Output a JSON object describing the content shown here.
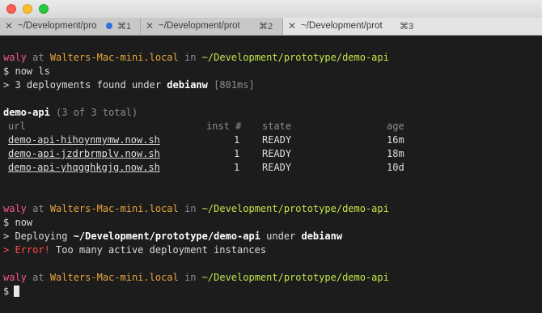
{
  "window": {
    "traffic_lights": [
      "close",
      "minimize",
      "zoom"
    ]
  },
  "tabs": [
    {
      "title": "~/Development/pro",
      "close": "✕",
      "has_dot": true,
      "shortcut": "⌘1"
    },
    {
      "title": "~/Development/prot",
      "close": "✕",
      "has_dot": false,
      "shortcut": "⌘2"
    },
    {
      "title": "~/Development/prot",
      "close": "✕",
      "has_dot": false,
      "shortcut": "⌘3"
    }
  ],
  "prompt": {
    "user": "waly",
    "at": " at ",
    "host": "Walters-Mac-mini.local",
    "in": " in ",
    "path": "~/Development/prototype/demo-api",
    "symbol": "$"
  },
  "block1": {
    "command": "now ls",
    "result_prefix": "> ",
    "result_count_text": "3 deployments found under ",
    "result_user": "debianw",
    "result_time": " [801ms]"
  },
  "list": {
    "app_name": "demo-api",
    "app_count": " (3 of 3 total)",
    "headers": {
      "url": "url",
      "inst": "inst #",
      "state": "state",
      "age": "age"
    },
    "rows": [
      {
        "url": "demo-api-hihoynmymw.now.sh",
        "inst": "1",
        "state": "READY",
        "age": "16m"
      },
      {
        "url": "demo-api-jzdrbrmplv.now.sh",
        "inst": "1",
        "state": "READY",
        "age": "18m"
      },
      {
        "url": "demo-api-yhqgghkgjg.now.sh",
        "inst": "1",
        "state": "READY",
        "age": "10d"
      }
    ]
  },
  "block2": {
    "command": "now",
    "deploy_prefix": "> Deploying ",
    "deploy_path": "~/Development/prototype/demo-api",
    "deploy_under": " under ",
    "deploy_user": "debianw",
    "error_prefix": "> Error!",
    "error_message": " Too many active deployment instances"
  },
  "colors": {
    "background": "#1c1c1c",
    "user": "#f5588b",
    "host": "#e6a53c",
    "path": "#c3e74a",
    "error": "#ff4b4b",
    "dim": "#8d8d8d"
  }
}
